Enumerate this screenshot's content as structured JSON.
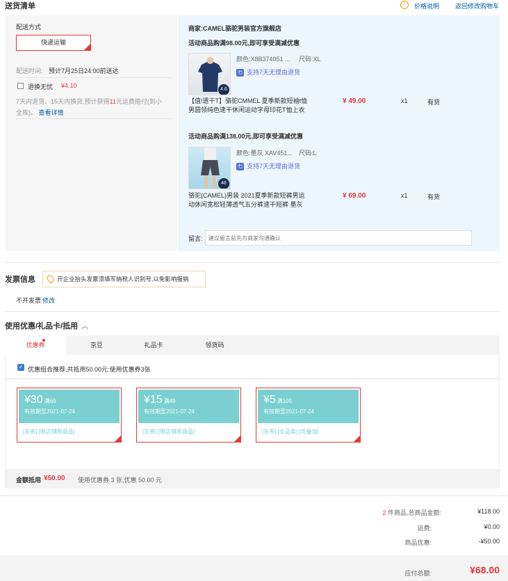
{
  "header": {
    "title": "送货清单",
    "price_info_label": "价格说明",
    "back_to_cart_link": "返回修改购物车"
  },
  "delivery": {
    "method_label": "配送方式",
    "method_button": "快递运输",
    "time_label": "配送时间:",
    "time_value": "预计7月25日24:00前送达",
    "return_label": "退换无忧",
    "return_price": "¥4.10",
    "return_desc_1": "7天内退货、15天内换货,预计获得",
    "return_desc_highlight": "11",
    "return_desc_2": "元运费赔付(到小",
    "return_desc_3": "全库)。",
    "return_detail_link": "查看详情"
  },
  "shop": {
    "seller": "商家:CAMEL骆驼男装官方旗舰店",
    "promo1": "活动商品购满98.00元,即可享受满减优惠",
    "promo2": "活动商品购满138.00元,即可享受满减优惠",
    "remark_label": "留言:",
    "remark_placeholder": "建议留言前先与商家沟通确认"
  },
  "products": [
    {
      "color": "颜色:X8B374051 ...",
      "size": "尺码:XL",
      "support": "支持7天无理由退货",
      "name_line1": "【值!遗干T】骆驼CMMEL 夏季新款短袖t恤",
      "name_line2": "男圆领纯色速干休闲运动字母印花T恤上衣",
      "price": "¥ 49.00",
      "qty": "x1",
      "stock": "有货",
      "badge": "4.6"
    },
    {
      "color": "颜色:墨灰 XAV451...",
      "size": "尺码:L",
      "support": "支持7天无理由退货",
      "name_line1": "骆驼(CAMEL)男装 2021夏季新款短裤男运",
      "name_line2": "动休闲宽松轻薄透气五分裤速干短裤 墨灰",
      "price": "¥ 69.00",
      "qty": "x1",
      "stock": "有货",
      "badge": "46"
    }
  ],
  "invoice": {
    "title": "发票信息",
    "tip": "开企业抬头发票须填写纳税人识别号,以免影响报销",
    "status": "不开发票",
    "modify_link": "修改"
  },
  "discount": {
    "title": "使用优惠/礼品卡/抵用",
    "tabs": [
      "优惠券",
      "京豆",
      "礼品卡",
      "领货码"
    ],
    "combo_text": "优惠组合推荐,共抵用50.00元:使用优惠券3张",
    "summary_label": "金额抵用",
    "summary_amount": "¥50.00",
    "summary_desc": "使用优惠券 3 张,优惠 50.00 元"
  },
  "coupons": [
    {
      "amount": "¥30",
      "cond": "满69",
      "expire": "有效期至2021-07-24",
      "tags": "[东券] [限店铺限商品]"
    },
    {
      "amount": "¥15",
      "cond": "满49",
      "expire": "有效期至2021-07-24",
      "tags": "[东券] [限店铺限商品]"
    },
    {
      "amount": "¥5",
      "cond": "满105",
      "expire": "有效期至2021-07-24",
      "tags": "[东券] [全品类] [可叠加]"
    }
  ],
  "totals": {
    "count_num": "2",
    "count_text": "件商品,总商品金额:",
    "goods_amount": "¥118.00",
    "shipping_label": "运费:",
    "shipping_amount": "¥0.00",
    "discount_label": "商品优惠:",
    "discount_amount": "-¥50.00",
    "payable_label": "应付总额:",
    "payable_amount": "¥68.00"
  },
  "colors": {
    "accent": "#e4393c",
    "link": "#005ea7",
    "coupon": "#7ad0d0",
    "shop_bg": "#eef6fd",
    "left_bg": "#f6f6f6"
  }
}
